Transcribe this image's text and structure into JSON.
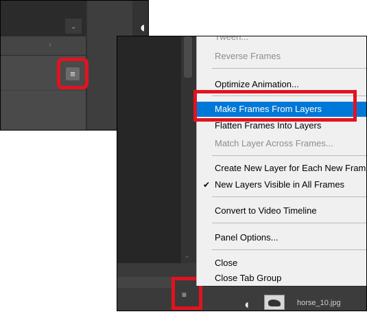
{
  "colors": {
    "highlight_red": "#e3121f",
    "menu_highlight": "#0078d7",
    "menu_bg": "#f0f0f0",
    "panel_dark": "#2a2a2a"
  },
  "icons": {
    "panel_menu": "hamburger-menu-icon",
    "visibility": "eye-icon"
  },
  "menu": {
    "items": [
      {
        "label": "Tween...",
        "state": "disabled"
      },
      {
        "label": "Reverse Frames",
        "state": "disabled"
      },
      {
        "label": "Optimize Animation...",
        "state": "enabled"
      },
      {
        "label": "Make Frames From Layers",
        "state": "highlighted"
      },
      {
        "label": "Flatten Frames Into Layers",
        "state": "enabled"
      },
      {
        "label": "Match Layer Across Frames...",
        "state": "disabled"
      },
      {
        "label": "Create New Layer for Each New Frame",
        "state": "enabled"
      },
      {
        "label": "New Layers Visible in All Frames",
        "state": "checked"
      },
      {
        "label": "Convert to Video Timeline",
        "state": "enabled"
      },
      {
        "label": "Panel Options...",
        "state": "enabled"
      },
      {
        "label": "Close",
        "state": "enabled"
      },
      {
        "label": "Close Tab Group",
        "state": "enabled"
      }
    ]
  },
  "layers": {
    "visible_layer_name": "horse_10.jpg"
  },
  "glyphs": {
    "check": "✔",
    "chevron_down": "⌄",
    "chevron_right": "›",
    "menu_lines": "≡",
    "eye": "◖"
  }
}
